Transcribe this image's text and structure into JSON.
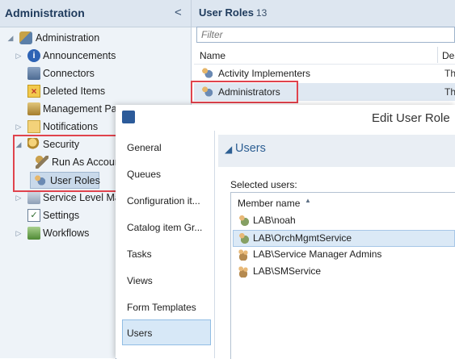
{
  "left_pane": {
    "title": "Administration",
    "collapse_glyph": "<",
    "tree": [
      {
        "label": "Administration",
        "icon": "administration-icon",
        "expander": "◢"
      },
      {
        "label": "Announcements",
        "icon": "announcements-icon",
        "expander": "▷"
      },
      {
        "label": "Connectors",
        "icon": "connectors-icon",
        "expander": ""
      },
      {
        "label": "Deleted Items",
        "icon": "deleted-items-icon",
        "expander": ""
      },
      {
        "label": "Management Pa",
        "icon": "management-packs-icon",
        "expander": ""
      },
      {
        "label": "Notifications",
        "icon": "notifications-icon",
        "expander": "▷"
      },
      {
        "label": "Security",
        "icon": "security-icon",
        "expander": "◢"
      },
      {
        "label": "Run As Accour",
        "icon": "run-as-accounts-icon",
        "expander": ""
      },
      {
        "label": "User Roles",
        "icon": "user-roles-icon",
        "expander": ""
      },
      {
        "label": "Service Level Ma",
        "icon": "service-level-management-icon",
        "expander": "▷"
      },
      {
        "label": "Settings",
        "icon": "settings-icon",
        "expander": ""
      },
      {
        "label": "Workflows",
        "icon": "workflows-icon",
        "expander": "▷"
      }
    ]
  },
  "right_pane": {
    "title": "User Roles",
    "count": "13",
    "filter_placeholder": "Filter",
    "columns": {
      "name": "Name",
      "description": "Des"
    },
    "rows": [
      {
        "name": "Activity Implementers",
        "desc": "Th"
      },
      {
        "name": "Administrators",
        "desc": "Th"
      }
    ]
  },
  "dialog": {
    "title": "Edit User Role",
    "nav": [
      "General",
      "Queues",
      "Configuration it...",
      "Catalog item Gr...",
      "Tasks",
      "Views",
      "Form Templates",
      "Users"
    ],
    "selected_nav": "Users",
    "section": {
      "title": "Users",
      "selected_users_label": "Selected users:",
      "member_column": "Member name",
      "users": [
        {
          "name": "LAB\\noah",
          "icon": "user-icon"
        },
        {
          "name": "LAB\\OrchMgmtService",
          "icon": "user-icon"
        },
        {
          "name": "LAB\\Service Manager Admins",
          "icon": "group-icon"
        },
        {
          "name": "LAB\\SMService",
          "icon": "group-icon"
        }
      ],
      "selected_user": "LAB\\OrchMgmtService"
    }
  },
  "colors": {
    "header_bg": "#dde6f0",
    "nav_bg": "#eef3f8",
    "selection": "#dbe9f6",
    "highlight_red": "#e0434d",
    "accent_blue": "#2d5f93"
  }
}
